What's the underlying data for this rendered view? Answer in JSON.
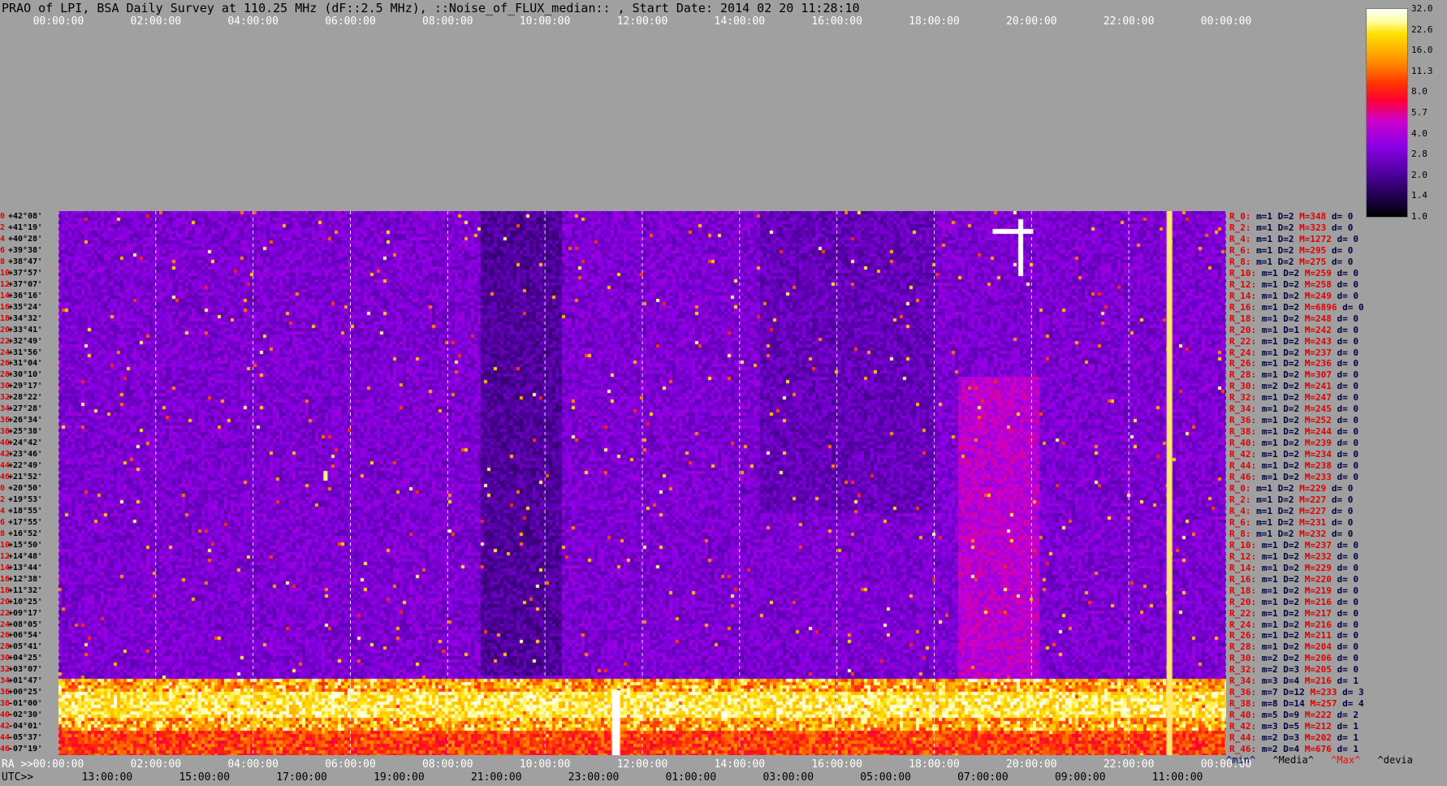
{
  "title": "PRAO of LPI, BSA Daily Survey at 110.25 MHz (dF::2.5 MHz), ::Noise_of_FLUX_median:: , Start Date: 2014 02 20 11:28:10",
  "top_axis": [
    "00:00:00",
    "02:00:00",
    "04:00:00",
    "06:00:00",
    "08:00:00",
    "10:00:00",
    "12:00:00",
    "14:00:00",
    "16:00:00",
    "18:00:00",
    "20:00:00",
    "22:00:00",
    "00:00:00"
  ],
  "ra_prefix": "RA >>",
  "ra_axis": [
    "00:00:00",
    "02:00:00",
    "04:00:00",
    "06:00:00",
    "08:00:00",
    "10:00:00",
    "12:00:00",
    "14:00:00",
    "16:00:00",
    "18:00:00",
    "20:00:00",
    "22:00:00",
    "00:00:00"
  ],
  "utc_prefix": "UTC>>",
  "utc_axis": [
    "13:00:00",
    "15:00:00",
    "17:00:00",
    "19:00:00",
    "21:00:00",
    "23:00:00",
    "01:00:00",
    "03:00:00",
    "05:00:00",
    "07:00:00",
    "09:00:00",
    "11:00:00"
  ],
  "colorbar": {
    "labels": [
      "32.0",
      "22.6",
      "16.0",
      "11.3",
      "8.0",
      "5.7",
      "4.0",
      "2.8",
      "2.0",
      "1.4",
      "1.0"
    ],
    "range": [
      1.0,
      32.0
    ],
    "scale": "log2"
  },
  "declinations": [
    {
      "n": "0",
      "d": "+42°08'"
    },
    {
      "n": "2",
      "d": "+41°19'"
    },
    {
      "n": "4",
      "d": "+40°28'"
    },
    {
      "n": "6",
      "d": "+39°38'"
    },
    {
      "n": "8",
      "d": "+38°47'"
    },
    {
      "n": "10",
      "d": "+37°57'"
    },
    {
      "n": "12",
      "d": "+37°07'"
    },
    {
      "n": "14",
      "d": "+36°16'"
    },
    {
      "n": "16",
      "d": "+35°24'"
    },
    {
      "n": "18",
      "d": "+34°32'"
    },
    {
      "n": "20",
      "d": "+33°41'"
    },
    {
      "n": "22",
      "d": "+32°49'"
    },
    {
      "n": "24",
      "d": "+31°56'"
    },
    {
      "n": "26",
      "d": "+31°04'"
    },
    {
      "n": "28",
      "d": "+30°10'"
    },
    {
      "n": "30",
      "d": "+29°17'"
    },
    {
      "n": "32",
      "d": "+28°22'"
    },
    {
      "n": "34",
      "d": "+27°28'"
    },
    {
      "n": "36",
      "d": "+26°34'"
    },
    {
      "n": "38",
      "d": "+25°38'"
    },
    {
      "n": "40",
      "d": "+24°42'"
    },
    {
      "n": "42",
      "d": "+23°46'"
    },
    {
      "n": "44",
      "d": "+22°49'"
    },
    {
      "n": "46",
      "d": "+21°52'"
    },
    {
      "n": "0",
      "d": "+20°50'"
    },
    {
      "n": "2",
      "d": "+19°53'"
    },
    {
      "n": "4",
      "d": "+18°55'"
    },
    {
      "n": "6",
      "d": "+17°55'"
    },
    {
      "n": "8",
      "d": "+16°52'"
    },
    {
      "n": "10",
      "d": "+15°50'"
    },
    {
      "n": "12",
      "d": "+14°48'"
    },
    {
      "n": "14",
      "d": "+13°44'"
    },
    {
      "n": "16",
      "d": "+12°38'"
    },
    {
      "n": "18",
      "d": "+11°32'"
    },
    {
      "n": "20",
      "d": "+10°25'"
    },
    {
      "n": "22",
      "d": "+09°17'"
    },
    {
      "n": "24",
      "d": "+08°05'"
    },
    {
      "n": "26",
      "d": "+06°54'"
    },
    {
      "n": "28",
      "d": "+05°41'"
    },
    {
      "n": "30",
      "d": "+04°25'"
    },
    {
      "n": "32",
      "d": "+03°07'"
    },
    {
      "n": "34",
      "d": "+01°47'"
    },
    {
      "n": "36",
      "d": "+00°25'"
    },
    {
      "n": "38",
      "d": "-01°00'"
    },
    {
      "n": "40",
      "d": "-02°30'"
    },
    {
      "n": "42",
      "d": "-04°01'"
    },
    {
      "n": "44",
      "d": "-05°37'"
    },
    {
      "n": "46",
      "d": "-07°19'"
    }
  ],
  "stats": [
    {
      "r": "R_0:",
      "m": "m=1",
      "D": "D=2",
      "M": "M=348",
      "d": "d= 0"
    },
    {
      "r": "R_2:",
      "m": "m=1",
      "D": "D=2",
      "M": "M=323",
      "d": "d= 0"
    },
    {
      "r": "R_4:",
      "m": "m=1",
      "D": "D=2",
      "M": "M=1272",
      "d": "d= 0"
    },
    {
      "r": "R_6:",
      "m": "m=1",
      "D": "D=2",
      "M": "M=295",
      "d": "d= 0"
    },
    {
      "r": "R_8:",
      "m": "m=1",
      "D": "D=2",
      "M": "M=275",
      "d": "d= 0"
    },
    {
      "r": "R_10:",
      "m": "m=1",
      "D": "D=2",
      "M": "M=259",
      "d": "d= 0"
    },
    {
      "r": "R_12:",
      "m": "m=1",
      "D": "D=2",
      "M": "M=258",
      "d": "d= 0"
    },
    {
      "r": "R_14:",
      "m": "m=1",
      "D": "D=2",
      "M": "M=249",
      "d": "d= 0"
    },
    {
      "r": "R_16:",
      "m": "m=1",
      "D": "D=2",
      "M": "M=6896",
      "d": "d= 0"
    },
    {
      "r": "R_18:",
      "m": "m=1",
      "D": "D=2",
      "M": "M=248",
      "d": "d= 0"
    },
    {
      "r": "R_20:",
      "m": "m=1",
      "D": "D=1",
      "M": "M=242",
      "d": "d= 0"
    },
    {
      "r": "R_22:",
      "m": "m=1",
      "D": "D=2",
      "M": "M=243",
      "d": "d= 0"
    },
    {
      "r": "R_24:",
      "m": "m=1",
      "D": "D=2",
      "M": "M=237",
      "d": "d= 0"
    },
    {
      "r": "R_26:",
      "m": "m=1",
      "D": "D=2",
      "M": "M=236",
      "d": "d= 0"
    },
    {
      "r": "R_28:",
      "m": "m=1",
      "D": "D=2",
      "M": "M=307",
      "d": "d= 0"
    },
    {
      "r": "R_30:",
      "m": "m=2",
      "D": "D=2",
      "M": "M=241",
      "d": "d= 0"
    },
    {
      "r": "R_32:",
      "m": "m=1",
      "D": "D=2",
      "M": "M=247",
      "d": "d= 0"
    },
    {
      "r": "R_34:",
      "m": "m=1",
      "D": "D=2",
      "M": "M=245",
      "d": "d= 0"
    },
    {
      "r": "R_36:",
      "m": "m=1",
      "D": "D=2",
      "M": "M=252",
      "d": "d= 0"
    },
    {
      "r": "R_38:",
      "m": "m=1",
      "D": "D=2",
      "M": "M=244",
      "d": "d= 0"
    },
    {
      "r": "R_40:",
      "m": "m=1",
      "D": "D=2",
      "M": "M=239",
      "d": "d= 0"
    },
    {
      "r": "R_42:",
      "m": "m=1",
      "D": "D=2",
      "M": "M=234",
      "d": "d= 0"
    },
    {
      "r": "R_44:",
      "m": "m=1",
      "D": "D=2",
      "M": "M=238",
      "d": "d= 0"
    },
    {
      "r": "R_46:",
      "m": "m=1",
      "D": "D=2",
      "M": "M=233",
      "d": "d= 0"
    },
    {
      "r": "R_0:",
      "m": "m=1",
      "D": "D=2",
      "M": "M=229",
      "d": "d= 0"
    },
    {
      "r": "R_2:",
      "m": "m=1",
      "D": "D=2",
      "M": "M=227",
      "d": "d= 0"
    },
    {
      "r": "R_4:",
      "m": "m=1",
      "D": "D=2",
      "M": "M=227",
      "d": "d= 0"
    },
    {
      "r": "R_6:",
      "m": "m=1",
      "D": "D=2",
      "M": "M=231",
      "d": "d= 0"
    },
    {
      "r": "R_8:",
      "m": "m=1",
      "D": "D=2",
      "M": "M=232",
      "d": "d= 0"
    },
    {
      "r": "R_10:",
      "m": "m=1",
      "D": "D=2",
      "M": "M=237",
      "d": "d= 0"
    },
    {
      "r": "R_12:",
      "m": "m=1",
      "D": "D=2",
      "M": "M=232",
      "d": "d= 0"
    },
    {
      "r": "R_14:",
      "m": "m=1",
      "D": "D=2",
      "M": "M=229",
      "d": "d= 0"
    },
    {
      "r": "R_16:",
      "m": "m=1",
      "D": "D=2",
      "M": "M=220",
      "d": "d= 0"
    },
    {
      "r": "R_18:",
      "m": "m=1",
      "D": "D=2",
      "M": "M=219",
      "d": "d= 0"
    },
    {
      "r": "R_20:",
      "m": "m=1",
      "D": "D=2",
      "M": "M=216",
      "d": "d= 0"
    },
    {
      "r": "R_22:",
      "m": "m=1",
      "D": "D=2",
      "M": "M=217",
      "d": "d= 0"
    },
    {
      "r": "R_24:",
      "m": "m=1",
      "D": "D=2",
      "M": "M=216",
      "d": "d= 0"
    },
    {
      "r": "R_26:",
      "m": "m=1",
      "D": "D=2",
      "M": "M=211",
      "d": "d= 0"
    },
    {
      "r": "R_28:",
      "m": "m=1",
      "D": "D=2",
      "M": "M=204",
      "d": "d= 0"
    },
    {
      "r": "R_30:",
      "m": "m=2",
      "D": "D=2",
      "M": "M=206",
      "d": "d= 0"
    },
    {
      "r": "R_32:",
      "m": "m=2",
      "D": "D=3",
      "M": "M=205",
      "d": "d= 0"
    },
    {
      "r": "R_34:",
      "m": "m=3",
      "D": "D=4",
      "M": "M=216",
      "d": "d= 1"
    },
    {
      "r": "R_36:",
      "m": "m=7",
      "D": "D=12",
      "M": "M=233",
      "d": "d= 3"
    },
    {
      "r": "R_38:",
      "m": "m=8",
      "D": "D=14",
      "M": "M=257",
      "d": "d= 4"
    },
    {
      "r": "R_40:",
      "m": "m=5",
      "D": "D=9",
      "M": "M=222",
      "d": "d= 2"
    },
    {
      "r": "R_42:",
      "m": "m=3",
      "D": "D=5",
      "M": "M=212",
      "d": "d= 1"
    },
    {
      "r": "R_44:",
      "m": "m=2",
      "D": "D=3",
      "M": "M=202",
      "d": "d= 1"
    },
    {
      "r": "R_46:",
      "m": "m=2",
      "D": "D=4",
      "M": "M=676",
      "d": "d= 1"
    }
  ],
  "legend": {
    "min": "^min^",
    "median": "^Media^",
    "max": "^Max^",
    "devia": "^devia"
  },
  "colors": {
    "background": "#a0a0a0",
    "label_red": "#e00000",
    "max_label": "#ff0000"
  },
  "chart_data": {
    "type": "heatmap",
    "title": "PRAO of LPI, BSA Daily Survey at 110.25 MHz (dF::2.5 MHz), ::Noise_of_FLUX_median:: , Start Date: 2014 02 20 11:28:10",
    "x_axis_ra": [
      "00:00:00",
      "02:00:00",
      "04:00:00",
      "06:00:00",
      "08:00:00",
      "10:00:00",
      "12:00:00",
      "14:00:00",
      "16:00:00",
      "18:00:00",
      "20:00:00",
      "22:00:00",
      "00:00:00"
    ],
    "x_axis_utc": [
      "13:00:00",
      "15:00:00",
      "17:00:00",
      "19:00:00",
      "21:00:00",
      "23:00:00",
      "01:00:00",
      "03:00:00",
      "05:00:00",
      "07:00:00",
      "09:00:00",
      "11:00:00"
    ],
    "y_axis": "declination beams +42°08' to -07°19'",
    "value_range": [
      1.0,
      32.0
    ],
    "scale": "log2",
    "bright_bands_dec": [
      "+01°47'",
      "+00°25'",
      "-01°00'",
      "-02°30'"
    ],
    "bright_sources_ra": [
      "06:00:00",
      "20:00:00",
      "12:00:00"
    ],
    "grid": true
  }
}
